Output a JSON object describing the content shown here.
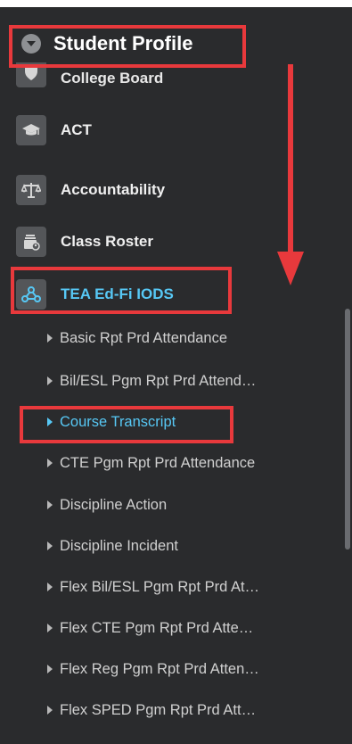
{
  "header": {
    "title": "Student Profile",
    "icon": "chevron-down-circle-icon"
  },
  "top_items": [
    {
      "label": "College Board",
      "icon": "shield-icon"
    },
    {
      "label": "ACT",
      "icon": "graduation-cap-icon"
    },
    {
      "label": "Accountability",
      "icon": "balance-scale-icon"
    },
    {
      "label": "Class Roster",
      "icon": "roster-icon"
    },
    {
      "label": "TEA Ed-Fi IODS",
      "icon": "network-icon"
    }
  ],
  "sub_items": [
    {
      "label": "Basic Rpt Prd Attendance"
    },
    {
      "label": "Bil/ESL Pgm Rpt Prd Attend…"
    },
    {
      "label": "Course Transcript"
    },
    {
      "label": "CTE Pgm Rpt Prd Attendance"
    },
    {
      "label": "Discipline Action"
    },
    {
      "label": "Discipline Incident"
    },
    {
      "label": "Flex Bil/ESL Pgm Rpt Prd At…"
    },
    {
      "label": "Flex CTE Pgm Rpt Prd Atte…"
    },
    {
      "label": "Flex Reg Pgm Rpt Prd Atten…"
    },
    {
      "label": "Flex SPED Pgm Rpt Prd Att…"
    }
  ],
  "colors": {
    "panel_bg": "#2a2b2d",
    "accent": "#57c8f5",
    "highlight": "#e8393c"
  }
}
